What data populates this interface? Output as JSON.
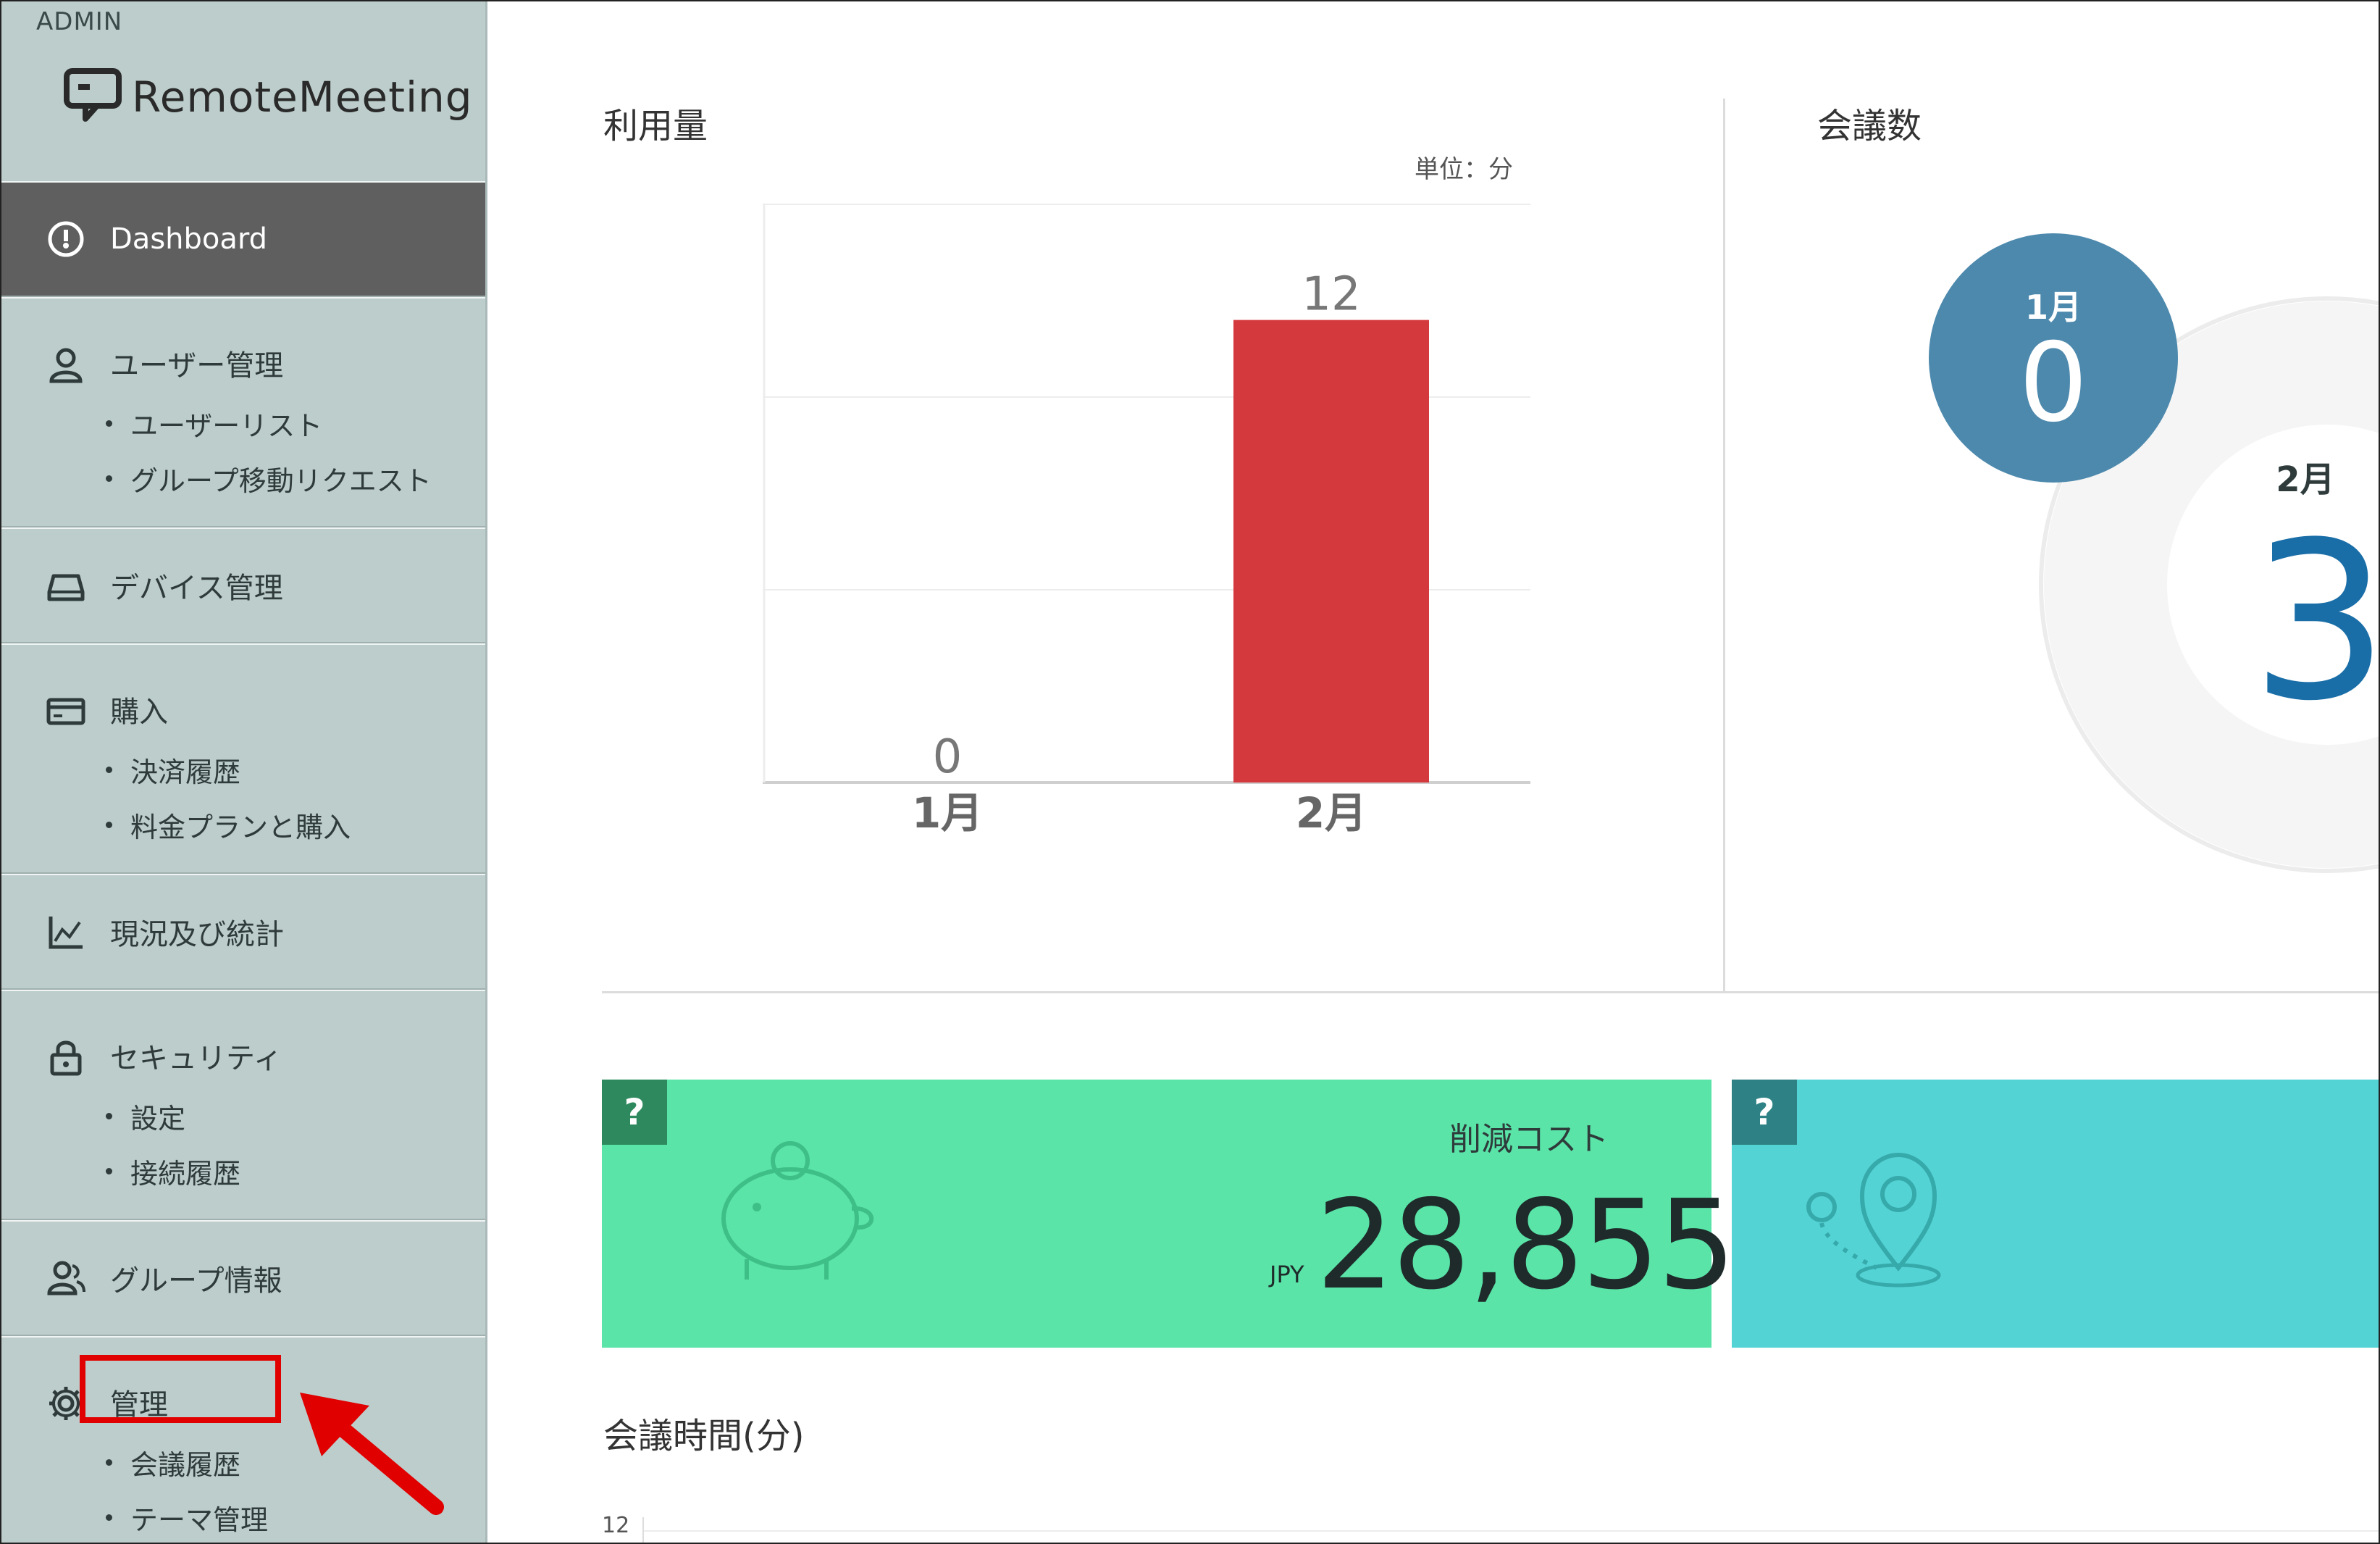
{
  "sidebar": {
    "admin_label": "ADMIN",
    "logo_text": "RemoteMeeting",
    "items": [
      {
        "label": "Dashboard",
        "icon": "dashboard-icon",
        "active": true,
        "subitems": []
      },
      {
        "label": "ユーザー管理",
        "icon": "user-icon",
        "subitems": [
          "ユーザーリスト",
          "グループ移動リクエスト"
        ]
      },
      {
        "label": "デバイス管理",
        "icon": "device-icon",
        "subitems": []
      },
      {
        "label": "購入",
        "icon": "card-icon",
        "subitems": [
          "決済履歴",
          "料金プランと購入"
        ]
      },
      {
        "label": "現況及び統計",
        "icon": "chart-icon",
        "subitems": []
      },
      {
        "label": "セキュリティ",
        "icon": "lock-icon",
        "subitems": [
          "設定",
          "接続履歴"
        ]
      },
      {
        "label": "グループ情報",
        "icon": "group-icon",
        "subitems": []
      },
      {
        "label": "管理",
        "icon": "gear-icon",
        "subitems": [
          "会議履歴",
          "テーマ管理"
        ]
      }
    ]
  },
  "usage": {
    "title": "利用量",
    "unit": "単位：分",
    "chart_data": {
      "type": "bar",
      "categories": [
        "1月",
        "2月"
      ],
      "values": [
        0,
        12
      ],
      "ylim": [
        0,
        15
      ],
      "grid": true
    }
  },
  "meetings": {
    "title": "会議数",
    "jan_label": "1月",
    "jan_value": "0",
    "feb_label": "2月",
    "feb_value": "3"
  },
  "cards": {
    "cost_label": "削減コスト",
    "cost_currency": "JPY",
    "cost_value": "28,855",
    "question_mark": "?"
  },
  "meeting_time": {
    "title": "会議時間(分)",
    "axis_tick": "12"
  },
  "colors": {
    "bar": "#d4393e",
    "green_card": "#5ae4a8",
    "teal_card": "#54d3d5",
    "blue_circle": "#4d89ad",
    "number_blue": "#1a6ea8"
  }
}
